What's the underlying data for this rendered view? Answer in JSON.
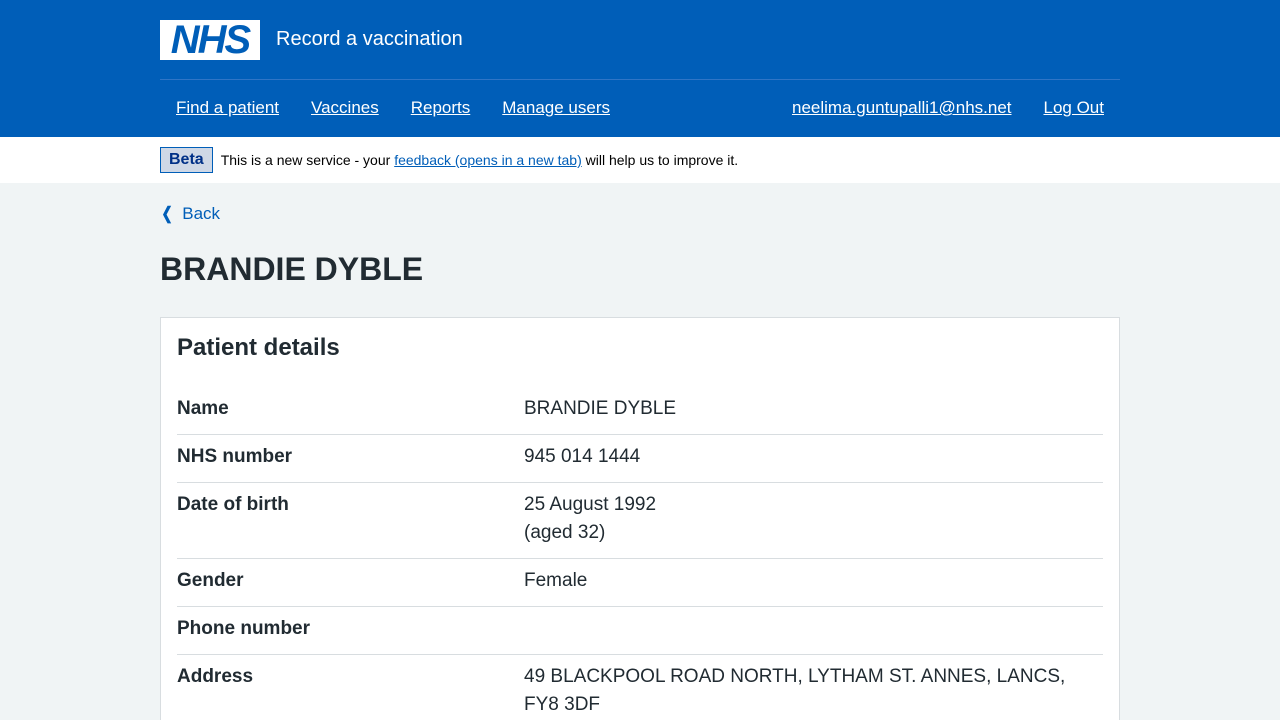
{
  "header": {
    "logo_text": "NHS",
    "service_name": "Record a vaccination",
    "nav_left": [
      "Find a patient",
      "Vaccines",
      "Reports",
      "Manage users"
    ],
    "user_email": "neelima.guntupalli1@nhs.net",
    "logout": "Log Out"
  },
  "beta": {
    "tag": "Beta",
    "text_before": "This is a new service - your ",
    "link": "feedback (opens in a new tab)",
    "text_after": " will help us to improve it."
  },
  "back": "Back",
  "page_title": "BRANDIE DYBLE",
  "card": {
    "title": "Patient details",
    "rows": [
      {
        "key": "Name",
        "value": "BRANDIE DYBLE"
      },
      {
        "key": "NHS number",
        "value": "945 014 1444"
      },
      {
        "key": "Date of birth",
        "value": "25 August 1992",
        "value2": "(aged 32)"
      },
      {
        "key": "Gender",
        "value": "Female"
      },
      {
        "key": "Phone number",
        "value": ""
      },
      {
        "key": "Address",
        "value": "49 BLACKPOOL ROAD NORTH, LYTHAM ST. ANNES, LANCS,",
        "value2": "FY8 3DF"
      }
    ]
  },
  "colors": {
    "brand": "#005eb8",
    "text": "#212b32",
    "background": "#f0f4f5"
  }
}
